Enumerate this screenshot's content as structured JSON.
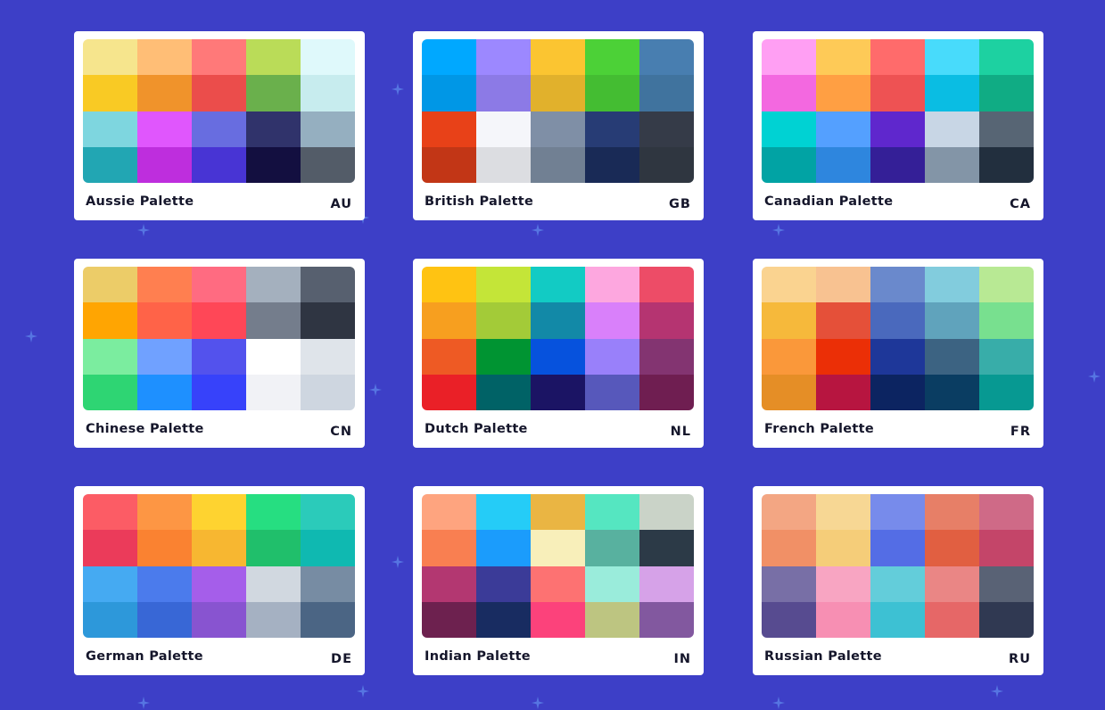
{
  "palettes": [
    {
      "name": "Aussie Palette",
      "code": "AU",
      "colors": [
        "#f6e58d",
        "#ffbe76",
        "#ff7979",
        "#badc58",
        "#dff9fb",
        "#f9ca24",
        "#f0932b",
        "#eb4d4b",
        "#6ab04c",
        "#c7ecee",
        "#7ed6df",
        "#e056fd",
        "#686de0",
        "#30336b",
        "#95afc0",
        "#22a6b3",
        "#be2edd",
        "#4834d4",
        "#130f40",
        "#535c68"
      ]
    },
    {
      "name": "British Palette",
      "code": "GB",
      "colors": [
        "#00a8ff",
        "#9c88ff",
        "#fbc531",
        "#4cd137",
        "#487eb0",
        "#0097e6",
        "#8c7ae6",
        "#e1b12c",
        "#44bd32",
        "#40739e",
        "#e84118",
        "#f5f6fa",
        "#7f8fa6",
        "#273c75",
        "#353b48",
        "#c23616",
        "#dcdde1",
        "#718093",
        "#192a56",
        "#2f3640"
      ]
    },
    {
      "name": "Canadian Palette",
      "code": "CA",
      "colors": [
        "#ff9ff3",
        "#feca57",
        "#ff6b6b",
        "#48dbfb",
        "#1dd1a1",
        "#f368e0",
        "#ff9f43",
        "#ee5253",
        "#0abde3",
        "#10ac84",
        "#00d2d3",
        "#54a0ff",
        "#5f27cd",
        "#c8d6e5",
        "#576574",
        "#01a3a4",
        "#2e86de",
        "#341f97",
        "#8395a7",
        "#222f3e"
      ]
    },
    {
      "name": "Chinese Palette",
      "code": "CN",
      "colors": [
        "#eccc68",
        "#ff7f50",
        "#ff6b81",
        "#a4b0be",
        "#57606f",
        "#ffa502",
        "#ff6348",
        "#ff4757",
        "#747d8c",
        "#2f3542",
        "#7bed9f",
        "#70a1ff",
        "#5352ed",
        "#ffffff",
        "#dfe4ea",
        "#2ed573",
        "#1e90ff",
        "#3742fa",
        "#f1f2f6",
        "#ced6e0"
      ]
    },
    {
      "name": "Dutch Palette",
      "code": "NL",
      "colors": [
        "#ffc312",
        "#c4e538",
        "#12cbc4",
        "#fda7df",
        "#ed4c67",
        "#f79f1f",
        "#a3cb38",
        "#1289a7",
        "#d980fa",
        "#b53471",
        "#ee5a24",
        "#009432",
        "#0652dd",
        "#9980fa",
        "#833471",
        "#ea2027",
        "#006266",
        "#1b1464",
        "#5758bb",
        "#6f1e51"
      ]
    },
    {
      "name": "French Palette",
      "code": "FR",
      "colors": [
        "#fad390",
        "#f8c291",
        "#6a89cc",
        "#82ccdd",
        "#b8e994",
        "#f6b93b",
        "#e55039",
        "#4a69bd",
        "#60a3bc",
        "#78e08f",
        "#fa983a",
        "#eb2f06",
        "#1e3799",
        "#3c6382",
        "#38ada9",
        "#e58e26",
        "#b71540",
        "#0c2461",
        "#0a3d62",
        "#079992"
      ]
    },
    {
      "name": "German Palette",
      "code": "DE",
      "colors": [
        "#fc5c65",
        "#fd9644",
        "#fed330",
        "#26de81",
        "#2bcbba",
        "#eb3b5a",
        "#fa8231",
        "#f7b731",
        "#20bf6b",
        "#0fb9b1",
        "#45aaf2",
        "#4b7bec",
        "#a55eea",
        "#d1d8e0",
        "#778ca3",
        "#2d98da",
        "#3867d6",
        "#8854d0",
        "#a5b1c2",
        "#4b6584"
      ]
    },
    {
      "name": "Indian Palette",
      "code": "IN",
      "colors": [
        "#fea47f",
        "#25ccf7",
        "#eab543",
        "#55e6c1",
        "#cad3c8",
        "#f97f51",
        "#1b9cfc",
        "#f8efba",
        "#58b19f",
        "#2c3a47",
        "#b33771",
        "#3b3b98",
        "#fd7272",
        "#9aecdb",
        "#d6a2e8",
        "#6d214f",
        "#182c61",
        "#fc427b",
        "#bdc581",
        "#82589f"
      ]
    },
    {
      "name": "Russian Palette",
      "code": "RU",
      "colors": [
        "#f3a683",
        "#f7d794",
        "#778beb",
        "#e77f67",
        "#cf6a87",
        "#f19066",
        "#f5cd79",
        "#546de5",
        "#e15f41",
        "#c44569",
        "#786fa6",
        "#f8a5c2",
        "#63cdda",
        "#ea8685",
        "#596275",
        "#574b90",
        "#f78fb3",
        "#3dc1d3",
        "#e66767",
        "#303952"
      ]
    }
  ]
}
